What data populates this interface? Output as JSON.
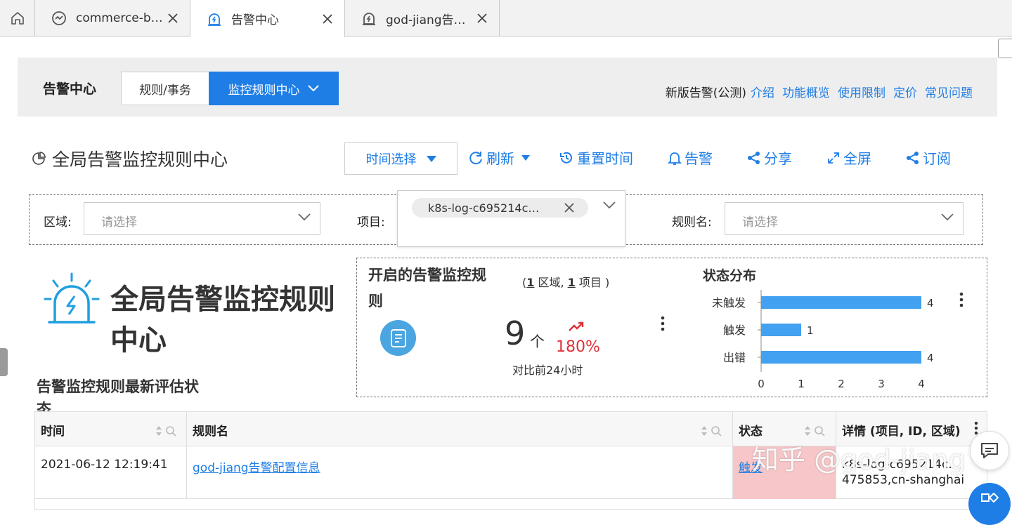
{
  "tabs": [
    {
      "label": "commerce-b…",
      "icon": "dashboard-icon",
      "active": false
    },
    {
      "label": "告警中心",
      "icon": "alert-icon",
      "active": true
    },
    {
      "label": "god-jiang告…",
      "icon": "alert-icon",
      "active": false
    }
  ],
  "header": {
    "title": "告警中心",
    "segments": [
      "规则/事务",
      "监控规则中心"
    ],
    "notice": "新版告警(公测)",
    "links": [
      "介绍",
      "功能概览",
      "使用限制",
      "定价",
      "常见问题"
    ]
  },
  "toolbar": {
    "page_title": "全局告警监控规则中心",
    "time_select": "时间选择",
    "refresh": "刷新",
    "reset_time": "重置时间",
    "alert": "告警",
    "share": "分享",
    "fullscreen": "全屏",
    "subscribe": "订阅"
  },
  "filters": {
    "region_label": "区域:",
    "region_placeholder": "请选择",
    "project_label": "项目:",
    "project_tag": "k8s-log-c695214c…",
    "rule_label": "规则名:",
    "rule_placeholder": "请选择"
  },
  "hero": {
    "title": "全局告警监控规则中心",
    "subtitle": "告警监控规则最新评估状态"
  },
  "stats": {
    "title": "开启的告警监控规则",
    "scope_prefix": "(",
    "region_count": "1",
    "scope_region": " 区域, ",
    "project_count": "1",
    "scope_project": " 项目 )",
    "count": "9",
    "unit": "个",
    "change": "180%",
    "compare": "对比前24小时",
    "dist_title": "状态分布",
    "accent_color": "#4aa5e0",
    "up_color": "#e0303a"
  },
  "chart_data": {
    "type": "bar",
    "orientation": "horizontal",
    "title": "状态分布",
    "categories": [
      "未触发",
      "触发",
      "出错"
    ],
    "values": [
      4,
      1,
      4
    ],
    "xlim": [
      0,
      4
    ],
    "xticks": [
      "0",
      "1",
      "2",
      "3",
      "4"
    ],
    "color": "#42a1f0"
  },
  "table": {
    "columns": [
      "时间",
      "规则名",
      "状态",
      "详情 (项目, ID, 区域)"
    ],
    "rows": [
      {
        "time": "2021-06-12 12:19:41",
        "rule": "god-jiang告警配置信息",
        "status": "触发",
        "detail_line1": "k8s-log-c695214c…",
        "detail_line2": "475853,cn-shanghai"
      }
    ]
  },
  "watermark": "知乎 @god-jiang"
}
